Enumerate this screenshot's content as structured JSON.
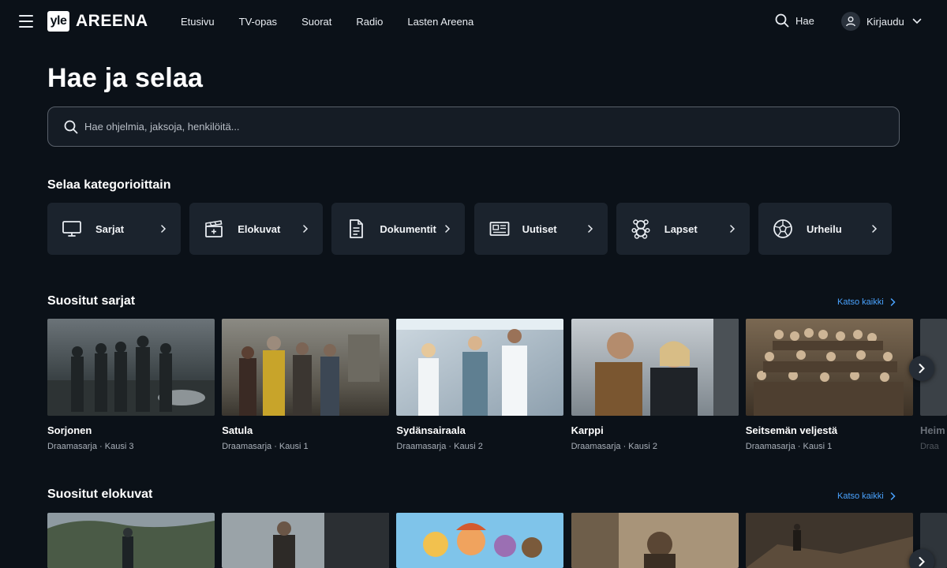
{
  "brand": {
    "logo_mark": "yle",
    "logo_text": "AREENA"
  },
  "nav": {
    "items": [
      "Etusivu",
      "TV-opas",
      "Suorat",
      "Radio",
      "Lasten Areena"
    ],
    "search_label": "Hae",
    "login_label": "Kirjaudu"
  },
  "page": {
    "title": "Hae ja selaa",
    "search_placeholder": "Hae ohjelmia, jaksoja, henkilöitä..."
  },
  "categories": {
    "title": "Selaa kategorioittain",
    "items": [
      {
        "label": "Sarjat",
        "icon": "tv-icon"
      },
      {
        "label": "Elokuvat",
        "icon": "clapperboard-icon"
      },
      {
        "label": "Dokumentit",
        "icon": "document-icon"
      },
      {
        "label": "Uutiset",
        "icon": "newspaper-icon"
      },
      {
        "label": "Lapset",
        "icon": "teddy-bear-icon"
      },
      {
        "label": "Urheilu",
        "icon": "football-icon"
      }
    ]
  },
  "popular_series": {
    "title": "Suositut sarjat",
    "see_all": "Katso kaikki",
    "items": [
      {
        "title": "Sorjonen",
        "subtitle": "Draamasarja · Kausi 3"
      },
      {
        "title": "Satula",
        "subtitle": "Draamasarja · Kausi 1"
      },
      {
        "title": "Sydänsairaala",
        "subtitle": "Draamasarja · Kausi 2"
      },
      {
        "title": "Karppi",
        "subtitle": "Draamasarja · Kausi 2"
      },
      {
        "title": "Seitsemän veljestä",
        "subtitle": "Draamasarja · Kausi 1"
      }
    ],
    "partial": {
      "title": "Heim",
      "subtitle": "Draa"
    }
  },
  "popular_movies": {
    "title": "Suositut elokuvat",
    "see_all": "Katso kaikki"
  },
  "colors": {
    "background": "#0b1118",
    "card": "#1b232d",
    "accent_link": "#4aa3ff"
  }
}
